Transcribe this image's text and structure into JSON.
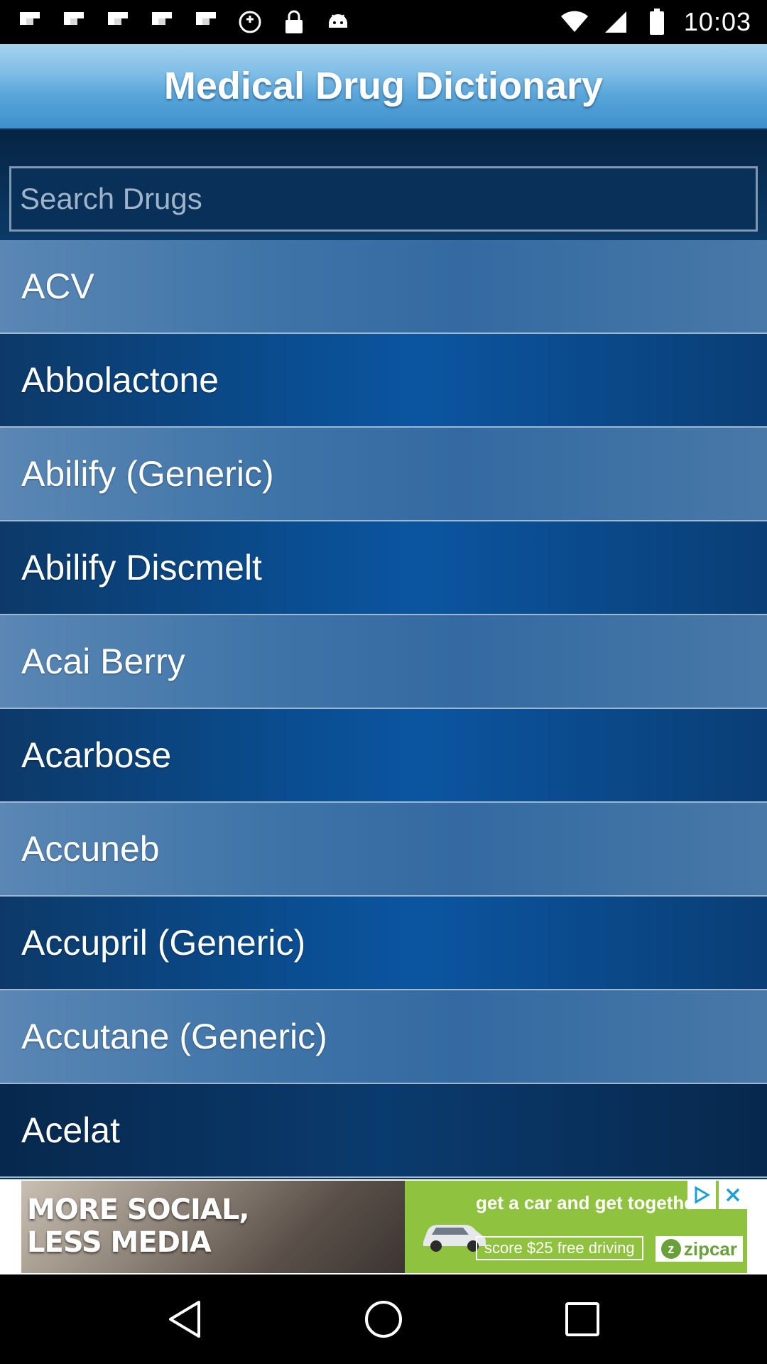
{
  "status_bar": {
    "time": "10:03",
    "left_icons": [
      "flipboard-icon",
      "flipboard-icon",
      "flipboard-icon",
      "flipboard-icon",
      "flipboard-icon",
      "data-saver-icon",
      "lock-icon",
      "android-icon"
    ],
    "right_icons": [
      "wifi-icon",
      "signal-icon",
      "battery-icon"
    ]
  },
  "header": {
    "title": "Medical Drug Dictionary",
    "gradient_top": "#a6d2ee",
    "gradient_bottom": "#3e8fcc"
  },
  "search": {
    "placeholder": "Search Drugs",
    "value": ""
  },
  "drugs": [
    {
      "label": "ACV"
    },
    {
      "label": "Abbolactone"
    },
    {
      "label": "Abilify (Generic)"
    },
    {
      "label": "Abilify Discmelt"
    },
    {
      "label": "Acai Berry"
    },
    {
      "label": "Acarbose"
    },
    {
      "label": "Accuneb"
    },
    {
      "label": "Accupril (Generic)"
    },
    {
      "label": "Accutane (Generic)"
    },
    {
      "label": "Acelat"
    }
  ],
  "ad": {
    "left_text": "MORE SOCIAL,\nLESS MEDIA",
    "headline": "get a car and get together.",
    "cta": "score $25 free driving",
    "brand": "zipcar",
    "brand_color": "#69a03a",
    "background_color": "#8fc23f"
  },
  "nav_bar": {
    "buttons": [
      "back-icon",
      "home-icon",
      "recents-icon"
    ]
  }
}
